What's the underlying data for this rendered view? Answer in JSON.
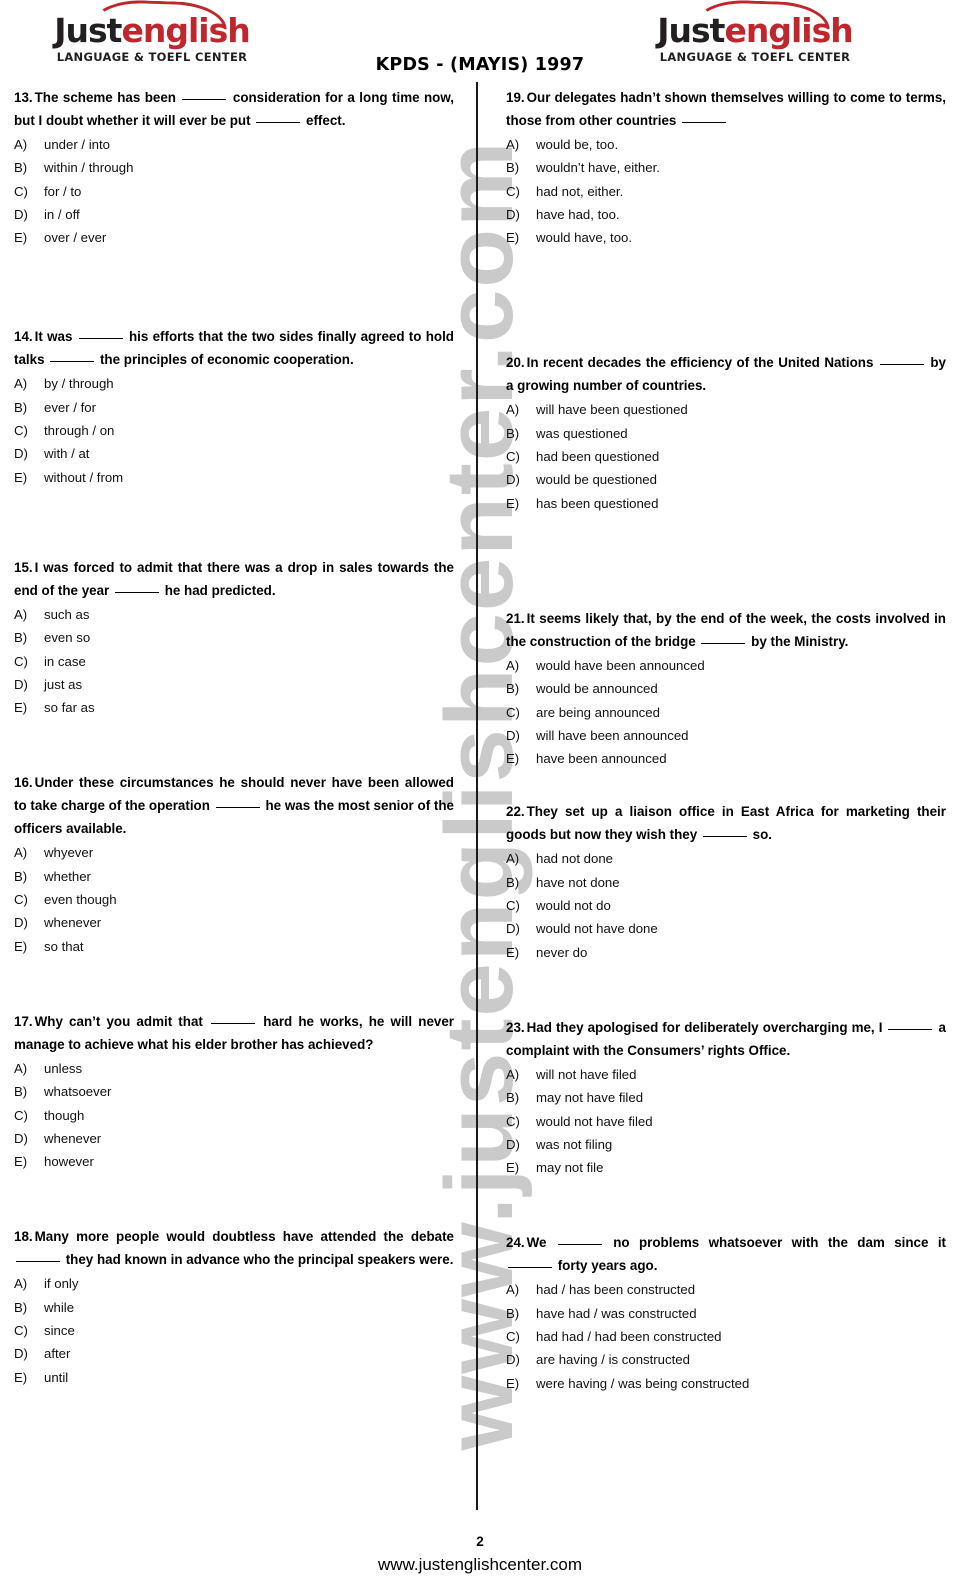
{
  "document": {
    "exam_title": "KPDS - (MAYIS) 1997",
    "page_number": "2",
    "footer_url": "www.justenglishcenter.com",
    "watermark_text": "www.justenglishcenter.com",
    "brand_accent_color": "#c0272d",
    "brand_dark_color": "#231f20",
    "divider_color": "#1a1a1a",
    "watermark_color": "#b9b9b9"
  },
  "logo": {
    "word_part1": "Just",
    "word_part2": "english",
    "subtitle": "LANGUAGE & TOEFL CENTER"
  },
  "left_column": [
    {
      "number": "13.",
      "stem_parts": [
        "The scheme has been ",
        " consideration for a long time now, but I doubt whether it will ever be put ",
        " effect."
      ],
      "options": [
        {
          "letter": "A)",
          "text": "under / into"
        },
        {
          "letter": "B)",
          "text": "within / through"
        },
        {
          "letter": "C)",
          "text": "for / to"
        },
        {
          "letter": "D)",
          "text": "in / off"
        },
        {
          "letter": "E)",
          "text": "over / ever"
        }
      ]
    },
    {
      "number": "14.",
      "stem_parts": [
        "It was ",
        " his efforts that the two sides finally agreed to hold talks ",
        " the principles of economic cooperation."
      ],
      "options": [
        {
          "letter": "A)",
          "text": "by / through"
        },
        {
          "letter": "B)",
          "text": "ever / for"
        },
        {
          "letter": "C)",
          "text": "through / on"
        },
        {
          "letter": "D)",
          "text": "with / at"
        },
        {
          "letter": "E)",
          "text": "without / from"
        }
      ]
    },
    {
      "number": "15.",
      "stem_parts": [
        "I was forced to admit that there was a drop in sales towards the end of the year ",
        " he had predicted."
      ],
      "options": [
        {
          "letter": "A)",
          "text": "such as"
        },
        {
          "letter": "B)",
          "text": "even so"
        },
        {
          "letter": "C)",
          "text": "in case"
        },
        {
          "letter": "D)",
          "text": "just as"
        },
        {
          "letter": "E)",
          "text": "so far as"
        }
      ]
    },
    {
      "number": "16.",
      "stem_parts": [
        "Under these circumstances he should never have been allowed to take charge of the operation ",
        " he was the most senior of the officers available."
      ],
      "options": [
        {
          "letter": "A)",
          "text": "whyever"
        },
        {
          "letter": "B)",
          "text": "whether"
        },
        {
          "letter": "C)",
          "text": "even though"
        },
        {
          "letter": "D)",
          "text": "whenever"
        },
        {
          "letter": "E)",
          "text": "so that"
        }
      ]
    },
    {
      "number": "17.",
      "stem_parts": [
        "Why can’t you admit that ",
        " hard he works, he will never manage to achieve what his elder brother has achieved?"
      ],
      "options": [
        {
          "letter": "A)",
          "text": "unless"
        },
        {
          "letter": "B)",
          "text": "whatsoever"
        },
        {
          "letter": "C)",
          "text": "though"
        },
        {
          "letter": "D)",
          "text": "whenever"
        },
        {
          "letter": "E)",
          "text": "however"
        }
      ]
    },
    {
      "number": "18.",
      "stem_parts": [
        "Many more people would doubtless have attended the debate ",
        " they had known in advance who the principal speakers were."
      ],
      "options": [
        {
          "letter": "A)",
          "text": "if only"
        },
        {
          "letter": "B)",
          "text": "while"
        },
        {
          "letter": "C)",
          "text": "since"
        },
        {
          "letter": "D)",
          "text": "after"
        },
        {
          "letter": "E)",
          "text": "until"
        }
      ]
    }
  ],
  "right_column": [
    {
      "number": "19.",
      "stem_parts": [
        "Our delegates hadn’t shown themselves willing to come to terms, those from other countries ",
        ""
      ],
      "options": [
        {
          "letter": "A)",
          "text": "would be, too."
        },
        {
          "letter": "B)",
          "text": "wouldn’t have, either."
        },
        {
          "letter": "C)",
          "text": "had not, either."
        },
        {
          "letter": "D)",
          "text": "have had, too."
        },
        {
          "letter": "E)",
          "text": "would have, too."
        }
      ]
    },
    {
      "number": "20.",
      "stem_parts": [
        "In recent decades the efficiency of the United Nations ",
        " by a growing number of countries."
      ],
      "options": [
        {
          "letter": "A)",
          "text": "will have been questioned"
        },
        {
          "letter": "B)",
          "text": "was questioned"
        },
        {
          "letter": "C)",
          "text": "had been questioned"
        },
        {
          "letter": "D)",
          "text": "would be questioned"
        },
        {
          "letter": "E)",
          "text": "has been questioned"
        }
      ]
    },
    {
      "number": "21.",
      "stem_parts": [
        "It seems likely that, by the end of the week, the costs involved in the construction of the bridge ",
        " by the Ministry."
      ],
      "options": [
        {
          "letter": "A)",
          "text": "would have been announced"
        },
        {
          "letter": "B)",
          "text": "would be announced"
        },
        {
          "letter": "C)",
          "text": "are being announced"
        },
        {
          "letter": "D)",
          "text": "will have been announced"
        },
        {
          "letter": "E)",
          "text": "have been announced"
        }
      ]
    },
    {
      "number": "22.",
      "stem_parts": [
        "They set up a liaison office in East Africa for marketing their goods but now they wish they ",
        " so."
      ],
      "options": [
        {
          "letter": "A)",
          "text": "had not done"
        },
        {
          "letter": "B)",
          "text": "have not done"
        },
        {
          "letter": "C)",
          "text": "would not do"
        },
        {
          "letter": "D)",
          "text": "would not have done"
        },
        {
          "letter": "E)",
          "text": "never do"
        }
      ]
    },
    {
      "number": "23.",
      "stem_parts": [
        "Had they apologised for deliberately overcharging me, I ",
        " a complaint with the Consumers’ rights Office."
      ],
      "options": [
        {
          "letter": "A)",
          "text": "will not have filed"
        },
        {
          "letter": "B)",
          "text": "may not have filed"
        },
        {
          "letter": "C)",
          "text": "would not have filed"
        },
        {
          "letter": "D)",
          "text": "was not filing"
        },
        {
          "letter": "E)",
          "text": "may not file"
        }
      ]
    },
    {
      "number": "24.",
      "stem_parts": [
        "We ",
        " no problems whatsoever with the dam since it ",
        " forty years ago."
      ],
      "options": [
        {
          "letter": "A)",
          "text": "had / has been constructed"
        },
        {
          "letter": "B)",
          "text": "have had / was constructed"
        },
        {
          "letter": "C)",
          "text": "had had / had been constructed"
        },
        {
          "letter": "D)",
          "text": "are having / is constructed"
        },
        {
          "letter": "E)",
          "text": "were having / was being constructed"
        }
      ]
    }
  ]
}
